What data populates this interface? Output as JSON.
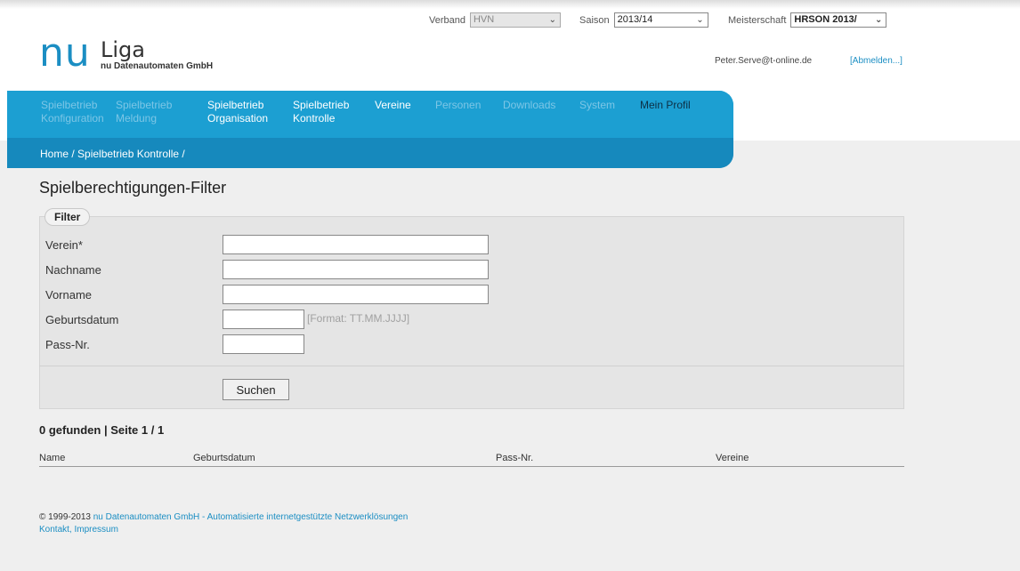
{
  "header": {
    "logo": {
      "nu": "nu",
      "liga": "Liga",
      "company": "nu Datenautomaten GmbH"
    },
    "verband": {
      "label": "Verband",
      "value": "HVN"
    },
    "saison": {
      "label": "Saison",
      "value": "2013/14"
    },
    "meisterschaft": {
      "label": "Meisterschaft",
      "value": "HRSON 2013/"
    },
    "user_email": "Peter.Serve@t-online.de",
    "logout_label": "[Abmelden...]"
  },
  "nav": {
    "items": [
      {
        "line1": "Spielbetrieb",
        "line2": "Konfiguration",
        "state": "inactive"
      },
      {
        "line1": "Spielbetrieb",
        "line2": "Meldung",
        "state": "inactive"
      },
      {
        "line1": "Spielbetrieb",
        "line2": "Organisation",
        "state": "active"
      },
      {
        "line1": "Spielbetrieb",
        "line2": "Kontrolle",
        "state": "active"
      },
      {
        "line1": "Vereine",
        "line2": "",
        "state": "active"
      },
      {
        "line1": "Personen",
        "line2": "",
        "state": "inactive"
      },
      {
        "line1": "Downloads",
        "line2": "",
        "state": "inactive"
      },
      {
        "line1": "System",
        "line2": "",
        "state": "inactive"
      },
      {
        "line1": "Mein Profil",
        "line2": "",
        "state": "profile"
      }
    ],
    "breadcrumb": "Home / Spielbetrieb Kontrolle /"
  },
  "main": {
    "title": "Spielberechtigungen-Filter",
    "filter": {
      "legend": "Filter",
      "fields": [
        {
          "label": "Verein*",
          "value": ""
        },
        {
          "label": "Nachname",
          "value": ""
        },
        {
          "label": "Vorname",
          "value": ""
        },
        {
          "label": "Geburtsdatum",
          "value": "",
          "hint": "[Format: TT.MM.JJJJ]"
        },
        {
          "label": "Pass-Nr.",
          "value": ""
        }
      ],
      "search_button": "Suchen"
    },
    "results": {
      "summary": "0 gefunden | Seite 1 / 1",
      "columns": [
        "Name",
        "Geburtsdatum",
        "Pass-Nr.",
        "Vereine"
      ]
    }
  },
  "footer": {
    "copyright": "© 1999-2013",
    "company_link": "nu Datenautomaten GmbH - Automatisierte internetgestützte Netzwerklösungen",
    "contact_link": "Kontakt, Impressum"
  },
  "colors": {
    "brand_blue": "#1b8ec3",
    "nav_blue": "#1c9fd2",
    "breadcrumb_blue": "#1689bd",
    "nav_inactive_text": "#7dc6e6",
    "page_background": "#efefef",
    "filter_background": "#e5e5e5"
  },
  "icons": {
    "dropdown": "chevron-down-icon"
  }
}
